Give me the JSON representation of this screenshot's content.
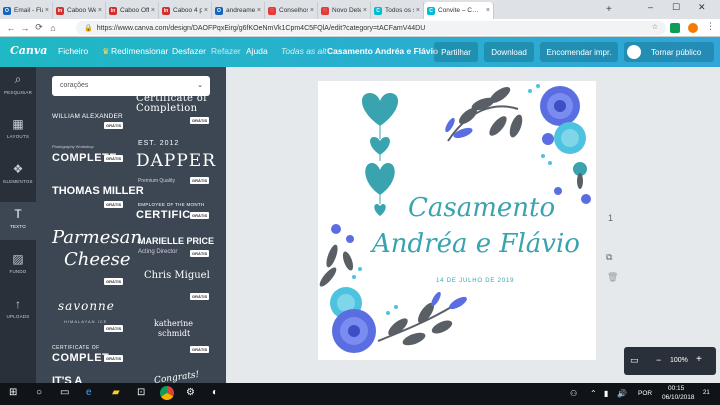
{
  "browser": {
    "tabs": [
      {
        "label": "Email - Flá…",
        "color": "#1565c0",
        "fav": "O"
      },
      {
        "label": "Caboo Welc…",
        "color": "#d32f2f",
        "fav": "in"
      },
      {
        "label": "Caboo Off…",
        "color": "#d32f2f",
        "fav": "in"
      },
      {
        "label": "Caboo 4 pr…",
        "color": "#d32f2f",
        "fav": "in"
      },
      {
        "label": "andreame…",
        "color": "#1565c0",
        "fav": "O"
      },
      {
        "label": "Conselhos…",
        "color": "#e53935",
        "fav": "♡"
      },
      {
        "label": "Novo Dete…",
        "color": "#e53935",
        "fav": "♡"
      },
      {
        "label": "Todos os sit…",
        "color": "#00bcd4",
        "fav": "C"
      },
      {
        "label": "Convite – C…",
        "color": "#00bcd4",
        "fav": "C"
      }
    ],
    "url": "https://www.canva.com/design/DAOFPqxEirg/g6fKOeNmVk1Cpm4C5FQlA/edit?category=tACFamV44DU"
  },
  "topbar": {
    "logo": "Canva",
    "menu_file": "Ficheiro",
    "menu_resize": "Redimensionar",
    "undo": "Desfazer",
    "redo": "Refazer",
    "help": "Ajuda",
    "status": "Todas as alt",
    "doc_title": "Casamento Andréa e Flávio",
    "share": "Partilhar",
    "download": "Download",
    "order": "Encomendar impr.",
    "public": "Tornar público"
  },
  "sidebar": {
    "items": [
      {
        "label": "PESQUISAR",
        "icon": "⌕"
      },
      {
        "label": "LAYOUTS",
        "icon": "▦"
      },
      {
        "label": "ELEMENTOS",
        "icon": "❖"
      },
      {
        "label": "TEXTO",
        "icon": "T"
      },
      {
        "label": "FUNDO",
        "icon": "▨"
      },
      {
        "label": "UPLOADS",
        "icon": "↑"
      }
    ]
  },
  "panel": {
    "search_value": "corações",
    "badge": "GRÁTIS",
    "samples": {
      "alexander": "WILLIAM ALEXANDER",
      "certificate": "Certificate of Completion",
      "photography": "Photography Workshop",
      "complete": "COMPLETE",
      "est": "EST. 2012",
      "dapper": "DAPPER",
      "premium": "Premium Quality",
      "thomas": "THOMAS MILLER",
      "employee": "EMPLOYEE OF THE MONTH",
      "certific": "CERTIFIC",
      "parmesan1": "Parmesan",
      "parmesan2": "Cheese",
      "marielle": "MARIELLE PRICE",
      "acting": "Acting Director",
      "chris": "Chris Miguel",
      "savonne": "savonne",
      "himalayan": "HIMALAYAN ICE",
      "katherine1": "katherine",
      "katherine2": "schmidt",
      "certificate2": "CERTIFICATE OF",
      "complete2": "COMPLET",
      "its": "IT'S A",
      "congrats": "Congrats!"
    }
  },
  "card": {
    "line1": "Casamento",
    "line2": "Andréa e Flávio",
    "date": "14 DE JULHO DE 2019"
  },
  "canvas_controls": {
    "page_num": "1",
    "zoom": "100%"
  },
  "taskbar": {
    "lang": "POR",
    "time": "00:15",
    "date": "06/10/2018",
    "notif": "21"
  },
  "colors": {
    "teal": "#3aa3b0",
    "blue_flower": "#5b6ee1",
    "light_blue_flower": "#4ec3e0",
    "leaf": "#5a5f66"
  }
}
